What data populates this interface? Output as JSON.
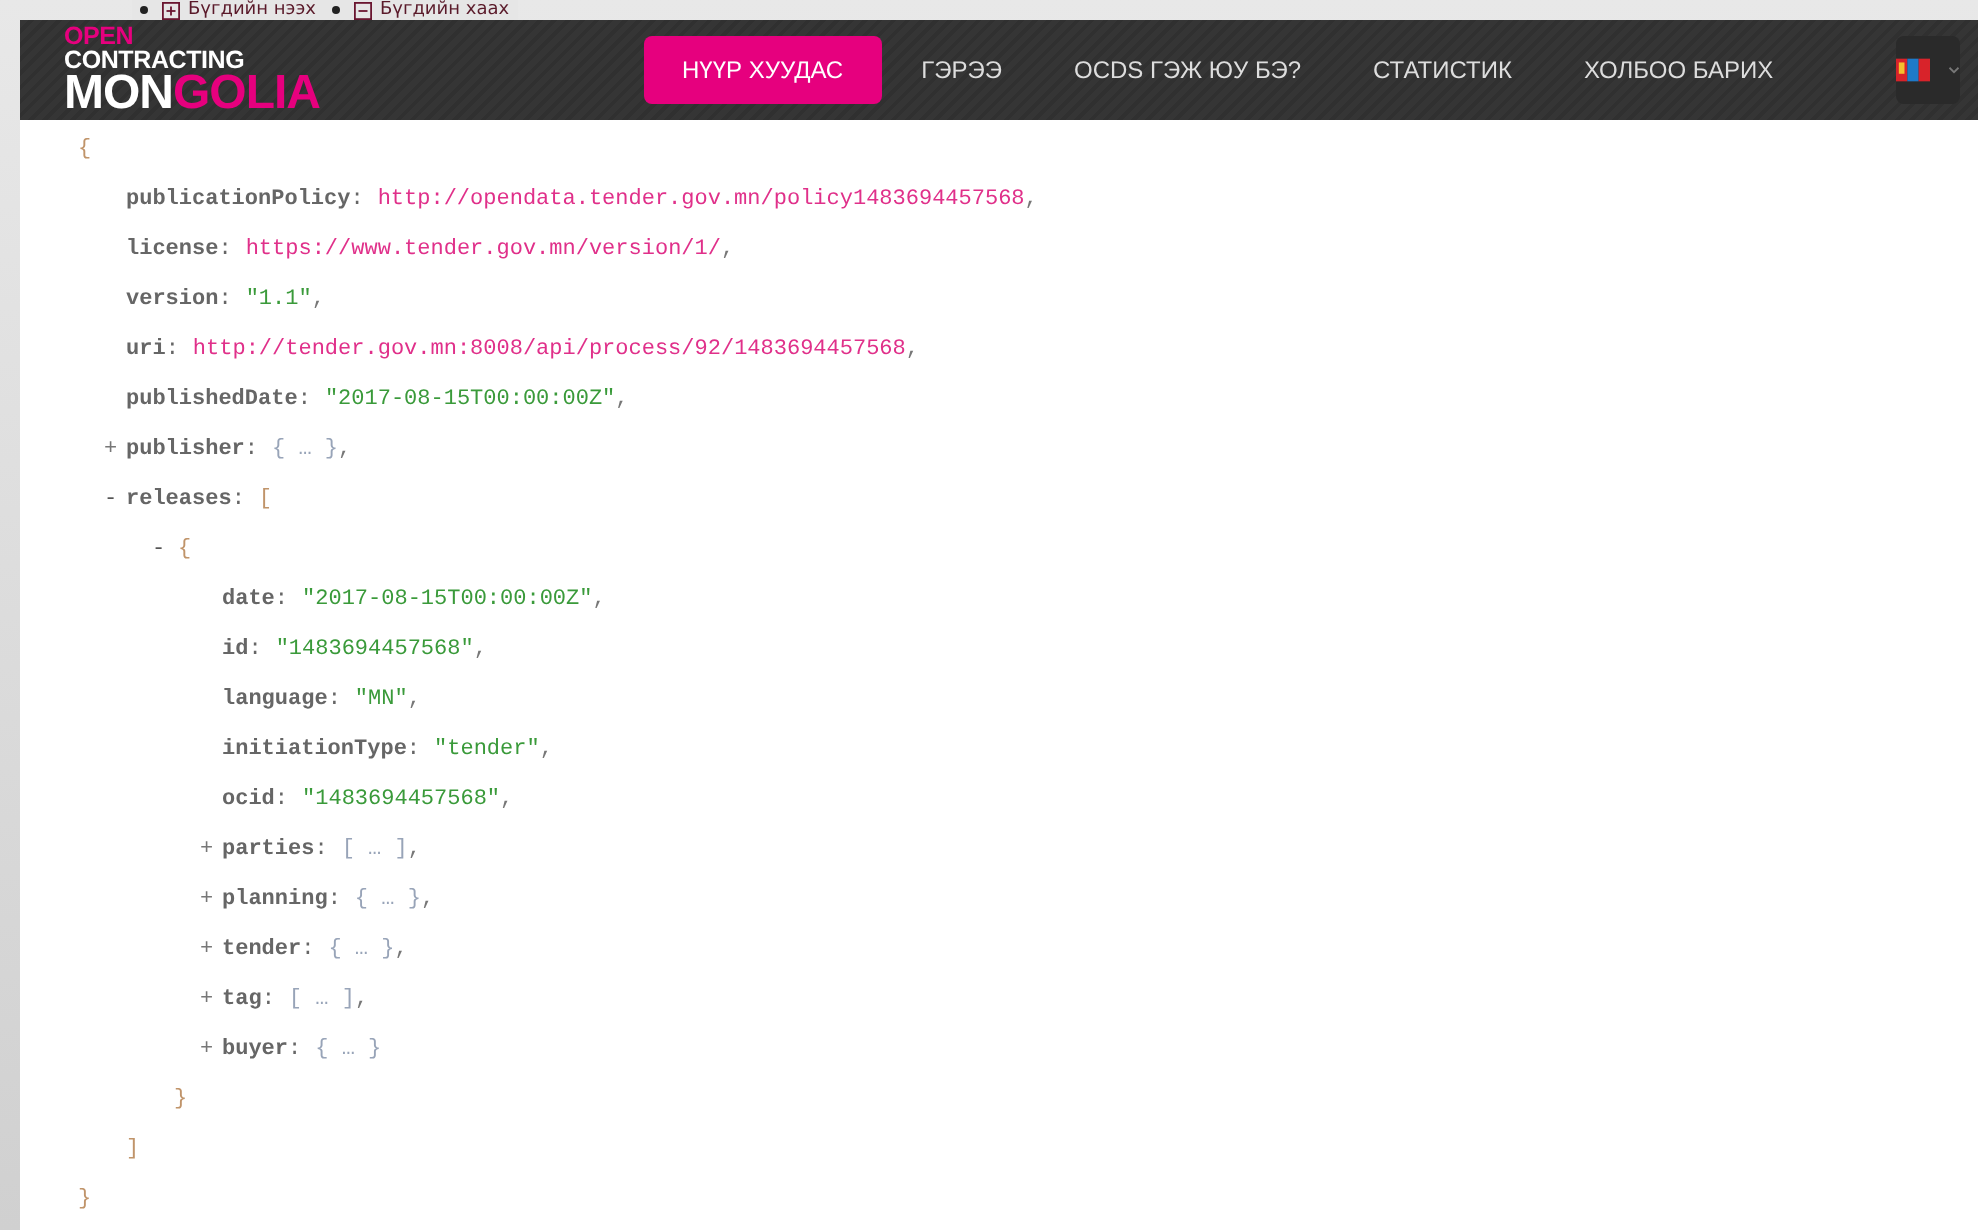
{
  "overlay_links": [
    {
      "label": "Бүгдийн нээх"
    },
    {
      "label": "Бүгдийн хаах"
    }
  ],
  "header": {
    "logo": {
      "top": [
        {
          "text": "OPEN",
          "color": "#e6007e"
        },
        {
          "text": " CONTRACTING",
          "color": "#ffffff"
        }
      ],
      "bottom": [
        {
          "text": "MON",
          "color": "#ffffff"
        },
        {
          "text": "GOLIA",
          "color": "#e6007e"
        }
      ]
    },
    "nav": [
      {
        "label": "НҮҮР ХУУДАС",
        "selected": true
      },
      {
        "label": "ГЭРЭЭ",
        "selected": false
      },
      {
        "label": "OCDS ГЭЖ ЮУ БЭ?",
        "selected": false
      },
      {
        "label": "СТАТИСТИК",
        "selected": false
      },
      {
        "label": "ХОЛБОО БАРИХ",
        "selected": false
      }
    ]
  },
  "viewer": {
    "open": "{",
    "close": "}",
    "members": [
      {
        "kind": "url",
        "key": "**publicationPolicy**:",
        "value": "http://opendata.tender.gov.mn/policy1483694457568",
        "comma": ","
      },
      {
        "kind": "url",
        "key": "**license**:",
        "value": "https://www.tender.gov.mn/version/1/",
        "comma": ","
      },
      {
        "kind": "string",
        "key": "**version**:",
        "value": "\"1.1\"",
        "comma": ","
      },
      {
        "kind": "url",
        "key": "**uri**:",
        "value": "http://tender.gov.mn:8008/api/process/92/1483694457568",
        "comma": ","
      },
      {
        "kind": "string",
        "key": "**publishedDate**:",
        "value": "\"2017-08-15T00:00:00Z\"",
        "comma": ","
      },
      {
        "kind": "collapsed",
        "toggle": "+",
        "expanded": false,
        "key": "**publisher**:",
        "value": "{ … }",
        "comma": ","
      },
      {
        "kind": "group",
        "toggle": "-",
        "expanded": true,
        "key": "**releases**:",
        "open": "[",
        "close": "]",
        "children": [
          {
            "kind": "group",
            "toggle": "-",
            "expanded": true,
            "open": "{",
            "close": "}",
            "children": [
              {
                "kind": "string",
                "key": "**date**:",
                "value": "\"2017-08-15T00:00:00Z\"",
                "comma": ","
              },
              {
                "kind": "string",
                "key": "**id**:",
                "value": "\"1483694457568\"",
                "comma": ","
              },
              {
                "kind": "string",
                "key": "**language**:",
                "value": "\"MN\"",
                "comma": ","
              },
              {
                "kind": "string",
                "key": "**initiationType**:",
                "value": "\"tender\"",
                "comma": ","
              },
              {
                "kind": "string",
                "key": "**ocid**:",
                "value": "\"1483694457568\"",
                "comma": ","
              },
              {
                "kind": "collapsed",
                "toggle": "+",
                "expanded": false,
                "key": "**parties**:",
                "value": "[ … ]",
                "comma": ","
              },
              {
                "kind": "collapsed",
                "toggle": "+",
                "expanded": false,
                "key": "**planning**:",
                "value": "{ … }",
                "comma": ","
              },
              {
                "kind": "collapsed",
                "toggle": "+",
                "expanded": false,
                "key": "**tender**:",
                "value": "{ … }",
                "comma": ","
              },
              {
                "kind": "collapsed",
                "toggle": "+",
                "expanded": false,
                "key": "**tag**:",
                "value": "[ … ]",
                "comma": ","
              },
              {
                "kind": "collapsed",
                "toggle": "+",
                "expanded": false,
                "key": "**buyer**:",
                "value": "{ … }"
              }
            ]
          }
        ]
      }
    ]
  }
}
